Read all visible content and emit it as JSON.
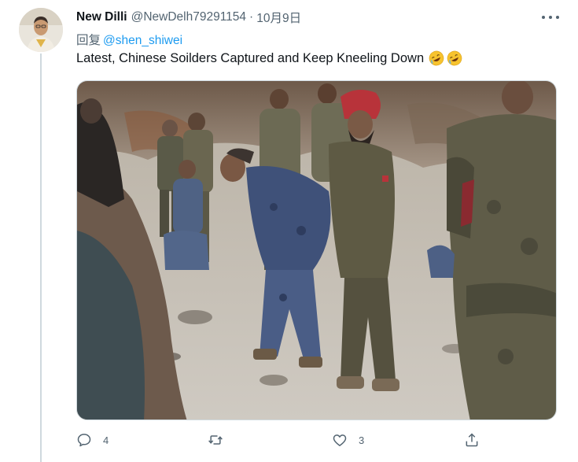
{
  "tweet": {
    "display_name": "New Dilli",
    "handle": "@NewDelh79291154",
    "separator": "·",
    "date": "10月9日",
    "reply_prefix": "回复",
    "reply_to": "@shen_shiwei",
    "text": "Latest, Chinese Soilders Captured and Keep Kneeling Down",
    "emoji": [
      "rofl-emoji",
      "rofl-emoji"
    ]
  },
  "actions": {
    "reply_count": "4",
    "retweet_count": "",
    "like_count": "3"
  },
  "colors": {
    "link": "#1d9bf0",
    "secondary_text": "#536471",
    "thread_line": "#cfd9de"
  },
  "icons": [
    "more-icon",
    "reply-icon",
    "retweet-icon",
    "like-icon",
    "share-icon"
  ]
}
